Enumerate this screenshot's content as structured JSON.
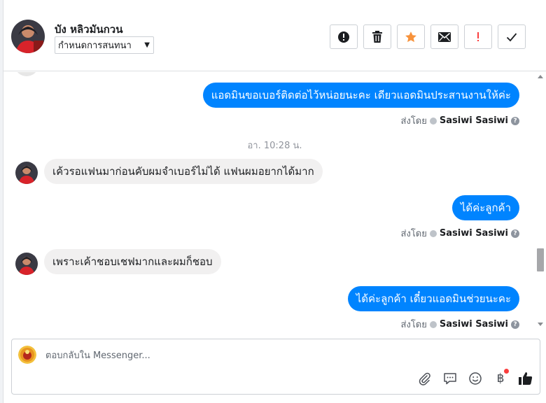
{
  "header": {
    "user_name": "บัง หลิวมันกวน",
    "assign_label": "กำหนดการสนทนา",
    "actions": [
      {
        "name": "spam",
        "icon": "alert-circle-icon"
      },
      {
        "name": "delete",
        "icon": "trash-icon"
      },
      {
        "name": "star",
        "icon": "star-icon",
        "color": "#f7923b"
      },
      {
        "name": "mark-unread",
        "icon": "envelope-icon"
      },
      {
        "name": "follow-up",
        "icon": "exclamation-icon",
        "color": "#fa3e3e"
      },
      {
        "name": "done",
        "icon": "checkmark-icon"
      }
    ]
  },
  "conversation": {
    "messages": [
      {
        "side": "out",
        "text": "แอดมินขอเบอร์ติดต่อไว้หน่อยนะคะ เดียวแอดมินประสานงานให้ค่ะ"
      },
      {
        "side": "in",
        "text": "เค้วรอแฟนมาก่อนคับผมจำเบอร์ไม่ได้ แฟนผมอยากได้มาก"
      },
      {
        "side": "out",
        "text": "ได้ค่ะลูกค้า"
      },
      {
        "side": "in",
        "text": "เพราะเค้าชอบเชฟมากและผมก็ชอบ"
      },
      {
        "side": "out",
        "text": "ได้ค่ะลูกค้า เดี๋ยวแอดมินช่วยนะคะ"
      }
    ],
    "timestamp": "อา. 10:28 น.",
    "sent_by_label": "ส่งโดย",
    "sender_name": "Sasiwi Sasiwi"
  },
  "composer": {
    "placeholder": "ตอบกลับใน Messenger...",
    "value": "",
    "tools": [
      "paperclip-icon",
      "speech-bubble-icon",
      "smiley-icon",
      "baht-icon",
      "thumbs-up-icon"
    ]
  },
  "colors": {
    "outgoing_bubble": "#0084ff",
    "incoming_bubble": "#f1f0f0",
    "star": "#f7923b",
    "follow_up": "#fa3e3e"
  }
}
